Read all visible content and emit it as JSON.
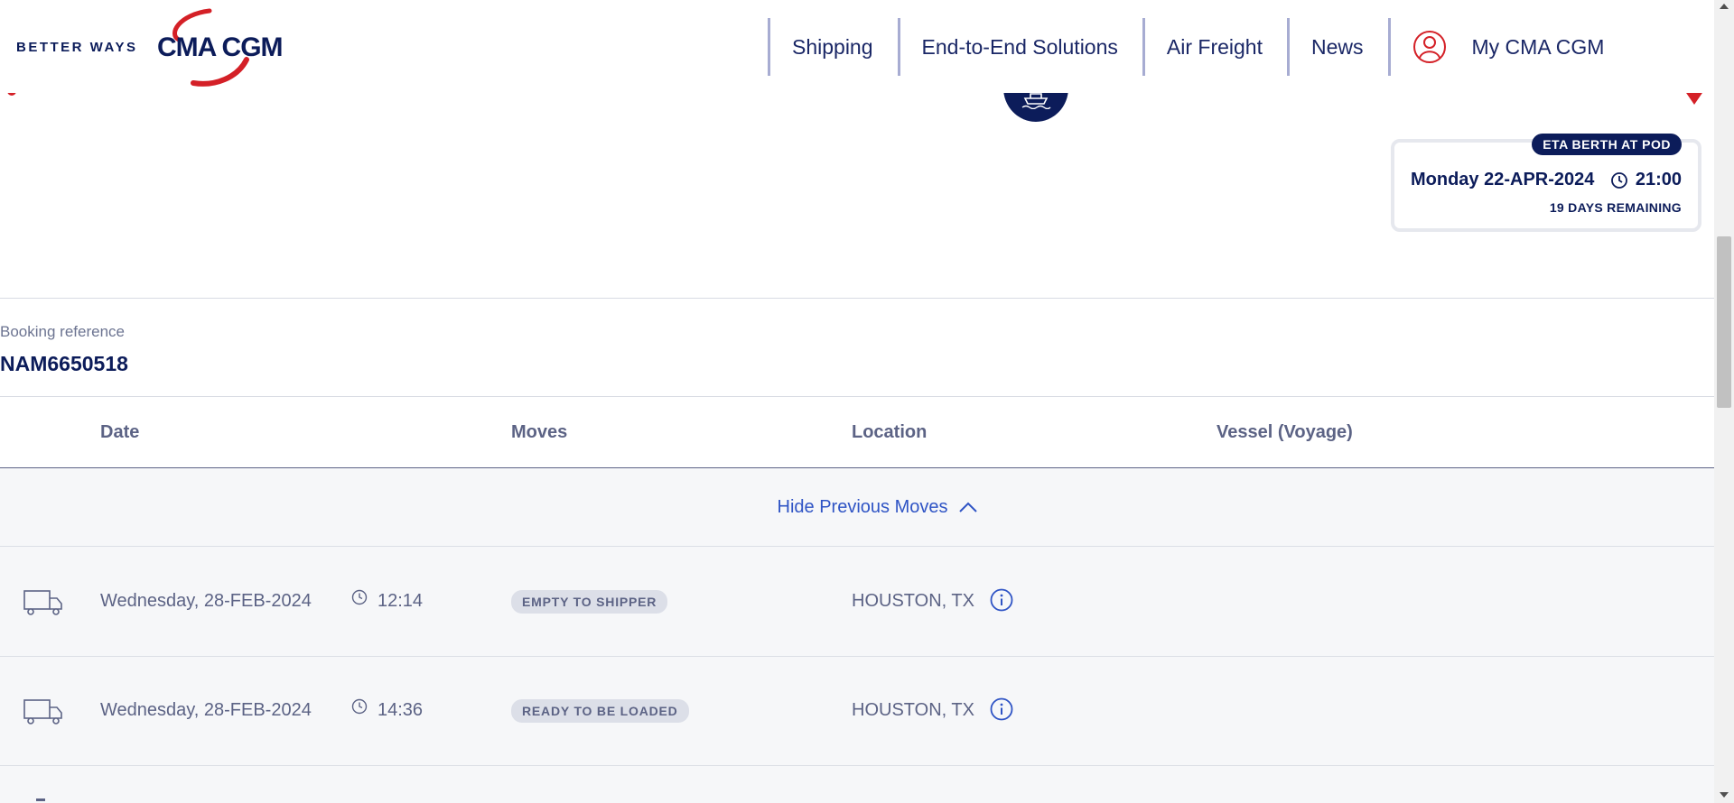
{
  "header": {
    "tagline": "BETTER WAYS",
    "brand": "CMA CGM",
    "nav": [
      {
        "label": "Shipping"
      },
      {
        "label": "End-to-End Solutions"
      },
      {
        "label": "Air Freight"
      },
      {
        "label": "News"
      },
      {
        "label": "My CMA CGM",
        "icon": "user-icon"
      }
    ]
  },
  "eta": {
    "badge": "ETA BERTH AT POD",
    "date": "Monday 22-APR-2024",
    "time": "21:00",
    "remaining": "19 DAYS REMAINING"
  },
  "booking": {
    "label": "Booking reference",
    "value": "NAM6650518"
  },
  "table": {
    "headers": {
      "date": "Date",
      "moves": "Moves",
      "location": "Location",
      "vessel": "Vessel (Voyage)"
    },
    "hide_label": "Hide Previous Moves",
    "rows": [
      {
        "date": "Wednesday, 28-FEB-2024",
        "time": "12:14",
        "move": "EMPTY TO SHIPPER",
        "location": "HOUSTON, TX",
        "vessel": ""
      },
      {
        "date": "Wednesday, 28-FEB-2024",
        "time": "14:36",
        "move": "READY TO BE LOADED",
        "location": "HOUSTON, TX",
        "vessel": ""
      }
    ]
  },
  "colors": {
    "brand_navy": "#0c1c5a",
    "brand_red": "#d42027",
    "link_blue": "#2f54c5",
    "row_bg": "#f6f7f9"
  }
}
